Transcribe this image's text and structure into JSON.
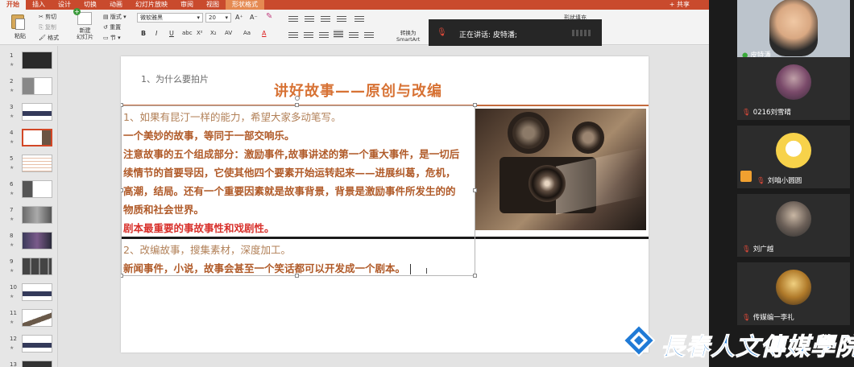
{
  "menubar": {
    "tabs": [
      "开始",
      "插入",
      "设计",
      "切换",
      "动画",
      "幻灯片放映",
      "审阅",
      "视图",
      "形状格式"
    ],
    "active_tab": 0,
    "share": "共享"
  },
  "ribbon": {
    "paste": "粘贴",
    "cut": "剪切",
    "copy": "复制",
    "format": "格式",
    "new_slide": "新建\n幻灯片",
    "layout": "版式",
    "reset": "重置",
    "section": "节",
    "font_name": "微软雅黑",
    "font_size": "20",
    "bold": "B",
    "italic": "I",
    "underline": "U",
    "strike": "abc",
    "superscript": "X²",
    "subscript": "X₂",
    "spacing": "AV",
    "case": "Aa",
    "font_color": "A",
    "grow": "A⁺",
    "shrink": "A⁻",
    "convert_smartart": "转换为\nSmartArt",
    "shape_fill": "形状填充"
  },
  "meeting": {
    "speaking": "正在讲话: 皮特潘;"
  },
  "thumbnails": [
    {
      "n": "1"
    },
    {
      "n": "2"
    },
    {
      "n": "3"
    },
    {
      "n": "4"
    },
    {
      "n": "5"
    },
    {
      "n": "6"
    },
    {
      "n": "7"
    },
    {
      "n": "8"
    },
    {
      "n": "9"
    },
    {
      "n": "10"
    },
    {
      "n": "11"
    },
    {
      "n": "12"
    },
    {
      "n": "13"
    }
  ],
  "slide": {
    "subtitle": "1、为什么要拍片",
    "title": "讲好故事——原创与改编",
    "lines": [
      "1、如果有昆汀一样的能力，希望大家多动笔写。",
      "一个美妙的故事，等同于一部交响乐。",
      "注意故事的五个组成部分：激励事件,故事讲述的第一个重大事件，是一切后",
      "续情节的首要导因，它使其他四个要素开始运转起来——进展纠葛，危机，",
      "高潮，结局。还有一个重要因素就是故事背景，背景是激励事件所发生的的",
      "物质和社会世界。",
      "剧本最重要的事故事性和戏剧性。",
      "2、改编故事，搜集素材，深度加工。",
      "新闻事件，小说，故事会甚至一个笑话都可以开发成一个剧本。"
    ]
  },
  "participants": [
    {
      "name": "皮特潘",
      "live": true
    },
    {
      "name": "0216刘雪晴"
    },
    {
      "name": "刘咱小圆圆"
    },
    {
      "name": "刘广越"
    },
    {
      "name": "传媒编一李礼"
    }
  ],
  "watermark": {
    "text": "長春人文傳媒學院"
  },
  "colors": {
    "accent": "#c94a2d",
    "title_orange": "#d77234",
    "body_brown": "#b05a28",
    "highlight_red": "#d8312c",
    "watermark_blue": "#1f7ad6"
  }
}
